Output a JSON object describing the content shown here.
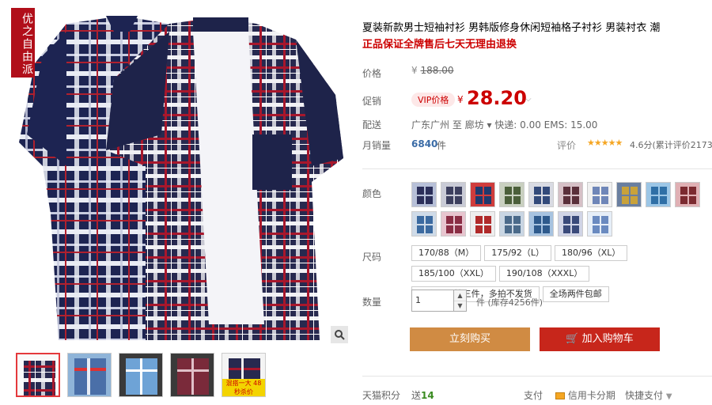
{
  "brand": {
    "tag": "优之自由派"
  },
  "product": {
    "title": "夏装新款男士短袖衬衫 男韩版修身休闲短袖格子衬衫 男装衬衣 潮",
    "subtitle": "正品保证全牌售后七天无理由退换"
  },
  "price": {
    "label": "价格",
    "currency": "¥",
    "original": "188.00"
  },
  "promo": {
    "label": "促销",
    "badge": "VIP价格",
    "currency": "¥",
    "value": "28.20"
  },
  "shipping": {
    "label": "配送",
    "text": "广东广州  至   廊坊 ▾  快递: 0.00 EMS: 15.00"
  },
  "sales": {
    "label": "月销量",
    "count": "6840",
    "unit": "件",
    "eval_label": "评价",
    "rating_text": "4.6分(累计评价2173"
  },
  "color": {
    "label": "颜色",
    "swatches": [
      {
        "c1": "#2b2f5a",
        "c2": "#b7c0d8"
      },
      {
        "c1": "#3c3f5e",
        "c2": "#c9cbd6"
      },
      {
        "c1": "#1e3a6e",
        "c2": "#cf3c3c"
      },
      {
        "c1": "#4b5f3a",
        "c2": "#c9d0c0"
      },
      {
        "c1": "#334a7a",
        "c2": "#d9dbe3"
      },
      {
        "c1": "#5a2f3a",
        "c2": "#d6c0c6"
      },
      {
        "c1": "#6f86b8",
        "c2": "#f0f0f0"
      },
      {
        "c1": "#c9a23a",
        "c2": "#6a7fa0"
      },
      {
        "c1": "#2f6fa6",
        "c2": "#9cc6e6"
      },
      {
        "c1": "#7b2a30",
        "c2": "#e0b0b4"
      },
      {
        "c1": "#3b6aa0",
        "c2": "#cfdbe8"
      },
      {
        "c1": "#8a2d44",
        "c2": "#e7c5cf"
      },
      {
        "c1": "#b02a2a",
        "c2": "#eee"
      },
      {
        "c1": "#4a6a8a",
        "c2": "#c9d6e3"
      },
      {
        "c1": "#2e5a8c",
        "c2": "#a7c3e0"
      },
      {
        "c1": "#3a4a7a",
        "c2": "#d0d4e6"
      },
      {
        "c1": "#6a8ac0",
        "c2": "#e6eef8"
      }
    ]
  },
  "size": {
    "label": "尺码",
    "options": [
      "170/88（M）",
      "175/92（L）",
      "180/96（XL）",
      "185/100（XXL）",
      "190/108（XXXL）",
      "一个ID限拍三件，多拍不发货",
      "全场两件包邮"
    ]
  },
  "quantity": {
    "label": "数量",
    "value": "1",
    "unit": "件",
    "stock": "(库存4256件)"
  },
  "buttons": {
    "buy": "立刻购买",
    "cart": "加入购物车"
  },
  "footer": {
    "points_label": "天猫积分",
    "points_prefix": "送",
    "points_value": "14",
    "pay_label": "支付",
    "card_pay": "信用卡分期",
    "quick_pay": "快捷支付"
  },
  "thumbs": {
    "caption": "混搭一大 48 秒杀价"
  }
}
